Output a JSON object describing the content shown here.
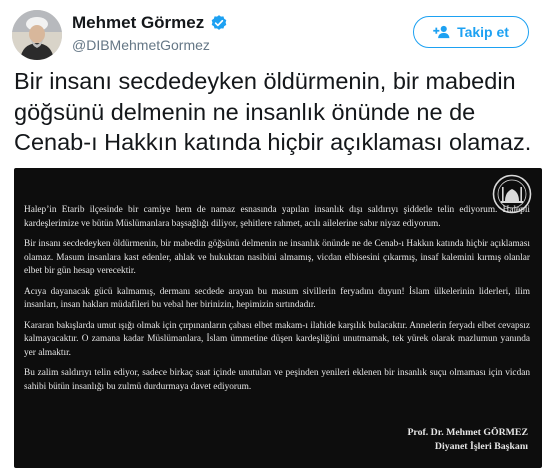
{
  "user": {
    "display_name": "Mehmet Görmez",
    "handle": "@DIBMehmetGormez",
    "verified_icon": "verified-badge-icon",
    "avatar_icon": "avatar"
  },
  "follow_button": {
    "label": "Takip et",
    "icon": "add-user-icon"
  },
  "tweet": {
    "text": "Bir insanı secdedeyken öldürmenin, bir mabedin göğsünü delmenin ne insanlık önünde ne de Cenab-ı Hakkın katında hiçbir açıklaması olamaz."
  },
  "statement": {
    "paragraphs": [
      "Halep’in Etarib ilçesinde bir camiye hem de namaz esnasında yapılan insanlık dışı saldırıyı şiddetle telin ediyorum. Halepli kardeşlerimize ve bütün Müslümanlara başsağlığı diliyor, şehitlere rahmet, acılı ailelerine sabır niyaz ediyorum.",
      "Bir insanı secdedeyken öldürmenin, bir mabedin göğsünü delmenin ne insanlık önünde ne de Cenab-ı Hakkın katında hiçbir açıklaması olamaz. Masum insanlara kast edenler, ahlak ve hukuktan nasibini almamış, vicdan elbisesini çıkarmış, insaf kalemini kırmış olanlar elbet bir gün hesap verecektir.",
      "Acıya dayanacak gücü kalmamış, dermanı secdede arayan bu masum sivillerin feryadını duyun! İslam ülkelerinin liderleri, ilim insanları, insan hakları müdafileri bu vebal her birinizin, hepimizin sırtındadır.",
      "Kararan bakışlarda umut ışığı olmak için çırpınanların çabası elbet makam-ı ilahide karşılık bulacaktır. Annelerin feryadı elbet cevapsız kalmayacaktır. O zamana kadar Müslümanlara, İslam ümmetine düşen kardeşliğini unutmamak, tek yürek olarak mazlumun yanında yer almaktır.",
      "Bu zalim saldırıyı telin ediyor, sadece birkaç saat içinde unutulan ve peşinden yenileri eklenen bir insanlık suçu olmaması için vicdan sahibi bütün insanlığı bu zulmü durdurmaya davet ediyorum."
    ],
    "signature_name": "Prof. Dr. Mehmet GÖRMEZ",
    "signature_title": "Diyanet İşleri Başkanı",
    "emblem_icon": "diyanet-emblem-icon"
  }
}
